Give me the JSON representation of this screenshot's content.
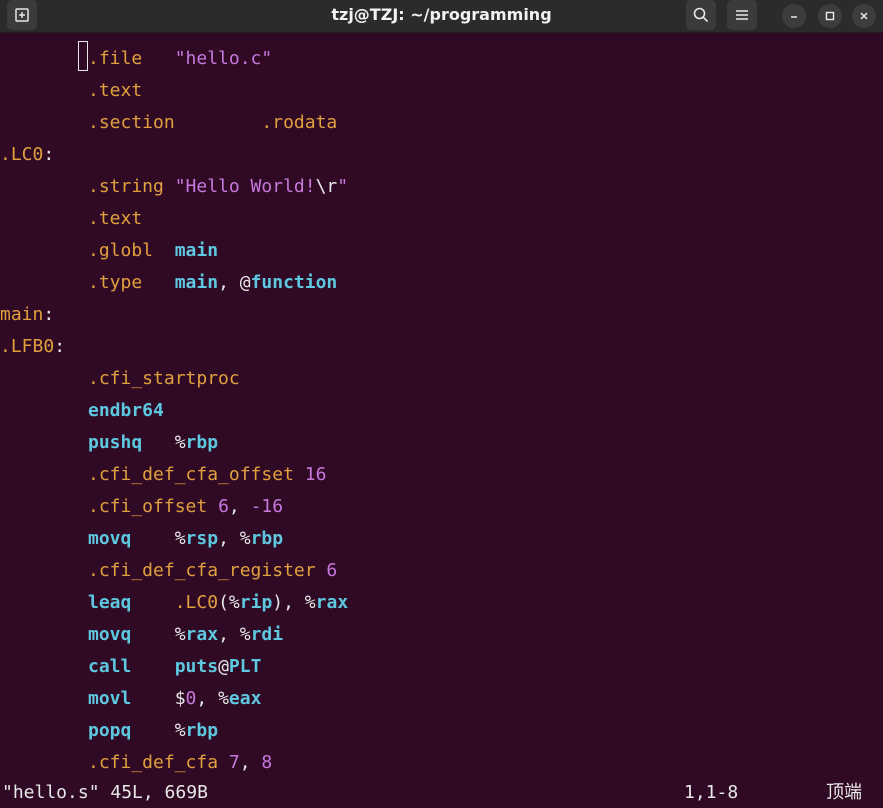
{
  "window": {
    "title": "tzj@TZJ: ~/programming"
  },
  "icons": {
    "new_tab": "new-tab-icon",
    "search": "search-icon",
    "menu": "menu-icon",
    "minimize": "minimize-icon",
    "maximize": "maximize-icon",
    "close": "close-icon"
  },
  "colors": {
    "background": "#300a24",
    "directive": "#e0a03e",
    "keyword": "#5ec8e0",
    "string_number": "#c678dd",
    "text": "#e8e8e8"
  },
  "code": {
    "l1": {
      "dir": ".file",
      "gap": "   ",
      "str": "\"hello.c\""
    },
    "l2": {
      "dir": ".text"
    },
    "l3": {
      "dir": ".section",
      "gap": "        ",
      "arg": ".rodata"
    },
    "l4": {
      "lbl": ".LC0",
      "colon": ":"
    },
    "l5": {
      "dir": ".string",
      "gap": " ",
      "str1": "\"Hello World!",
      "esc": "\\r",
      "str2": "\""
    },
    "l6": {
      "dir": ".text"
    },
    "l7": {
      "dir": ".globl",
      "gap": "  ",
      "kw": "main"
    },
    "l8": {
      "dir": ".type",
      "gap": "   ",
      "kw": "main",
      "sep": ", @",
      "kw2": "function"
    },
    "l9": {
      "lbl": "main",
      "colon": ":"
    },
    "l10": {
      "lbl": ".LFB0",
      "colon": ":"
    },
    "l11": {
      "dir": ".cfi_startproc"
    },
    "l12": {
      "kw": "endbr64"
    },
    "l13": {
      "kw": "pushq",
      "gap": "   %",
      "reg": "rbp"
    },
    "l14": {
      "dir": ".cfi_def_cfa_offset",
      "gap": " ",
      "num": "16"
    },
    "l15": {
      "dir": ".cfi_offset",
      "gap": " ",
      "num1": "6",
      "sep": ", ",
      "num2": "-16"
    },
    "l16": {
      "kw": "movq",
      "gap": "    %",
      "reg1": "rsp",
      "sep": ", %",
      "reg2": "rbp"
    },
    "l17": {
      "dir": ".cfi_def_cfa_register",
      "gap": " ",
      "num": "6"
    },
    "l18": {
      "kw": "leaq",
      "gap": "    ",
      "lbl": ".LC0",
      "p1": "(%",
      "reg1": "rip",
      "p2": "), %",
      "reg2": "rax"
    },
    "l19": {
      "kw": "movq",
      "gap": "    %",
      "reg1": "rax",
      "sep": ", %",
      "reg2": "rdi"
    },
    "l20": {
      "kw": "call",
      "gap": "    ",
      "fn": "puts",
      "at": "@",
      "plt": "PLT"
    },
    "l21": {
      "kw": "movl",
      "gap": "    $",
      "num": "0",
      "sep": ", %",
      "reg": "eax"
    },
    "l22": {
      "kw": "popq",
      "gap": "    %",
      "reg": "rbp"
    },
    "l23": {
      "dir": ".cfi_def_cfa",
      "gap": " ",
      "num1": "7",
      "sep": ", ",
      "num2": "8"
    }
  },
  "status": {
    "file_info": "\"hello.s\" 45L, 669B",
    "position": "1,1-8",
    "scroll": "顶端"
  }
}
